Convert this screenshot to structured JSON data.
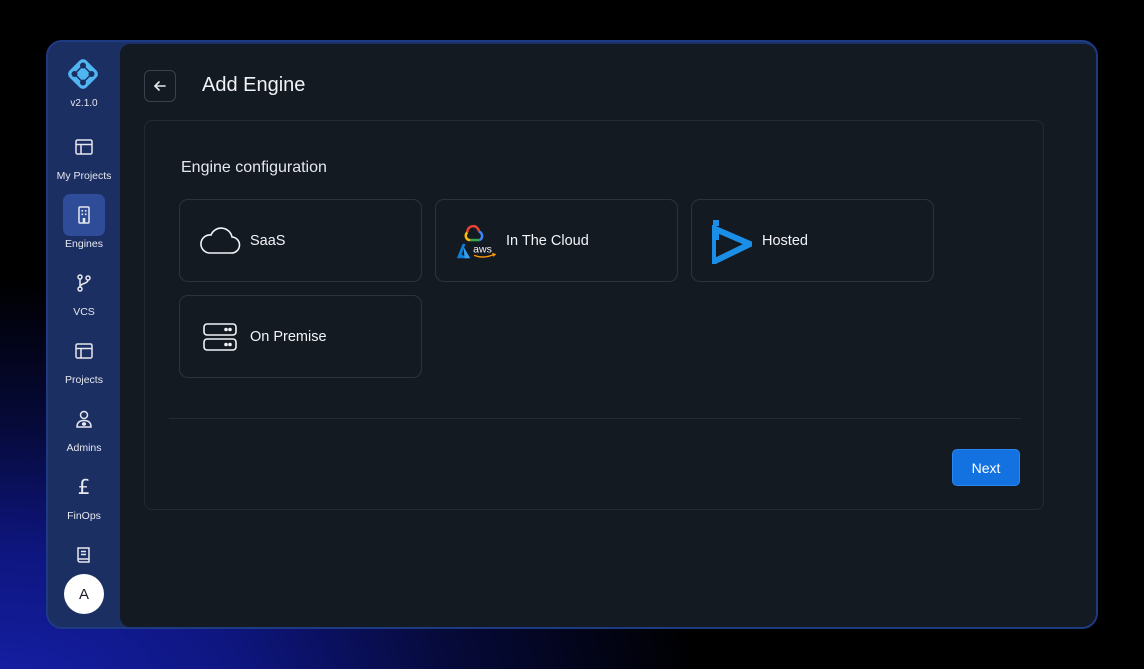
{
  "app": {
    "version": "v2.1.0"
  },
  "sidebar": {
    "items": [
      {
        "label": "My Projects",
        "icon": "layout-icon",
        "active": false
      },
      {
        "label": "Engines",
        "icon": "building-icon",
        "active": true
      },
      {
        "label": "VCS",
        "icon": "git-branch-icon",
        "active": false
      },
      {
        "label": "Projects",
        "icon": "layout-icon",
        "active": false
      },
      {
        "label": "Admins",
        "icon": "user-shield-icon",
        "active": false
      },
      {
        "label": "FinOps",
        "icon": "pound-icon",
        "active": false
      },
      {
        "label": "",
        "icon": "book-icon",
        "active": false
      }
    ],
    "avatar": "A"
  },
  "header": {
    "title": "Add Engine",
    "back_icon": "arrow-left-icon"
  },
  "config": {
    "title": "Engine configuration",
    "options": [
      {
        "label": "SaaS",
        "icon": "cloud-icon"
      },
      {
        "label": "In The Cloud",
        "icon": "cloud-providers-icon",
        "aws_text": "aws"
      },
      {
        "label": "Hosted",
        "icon": "hosted-logo-icon"
      },
      {
        "label": "On Premise",
        "icon": "server-icon"
      }
    ]
  },
  "actions": {
    "next_label": "Next"
  },
  "colors": {
    "accent": "#1371e0",
    "sidebar": "#1c2f63",
    "panel": "#141a22"
  }
}
